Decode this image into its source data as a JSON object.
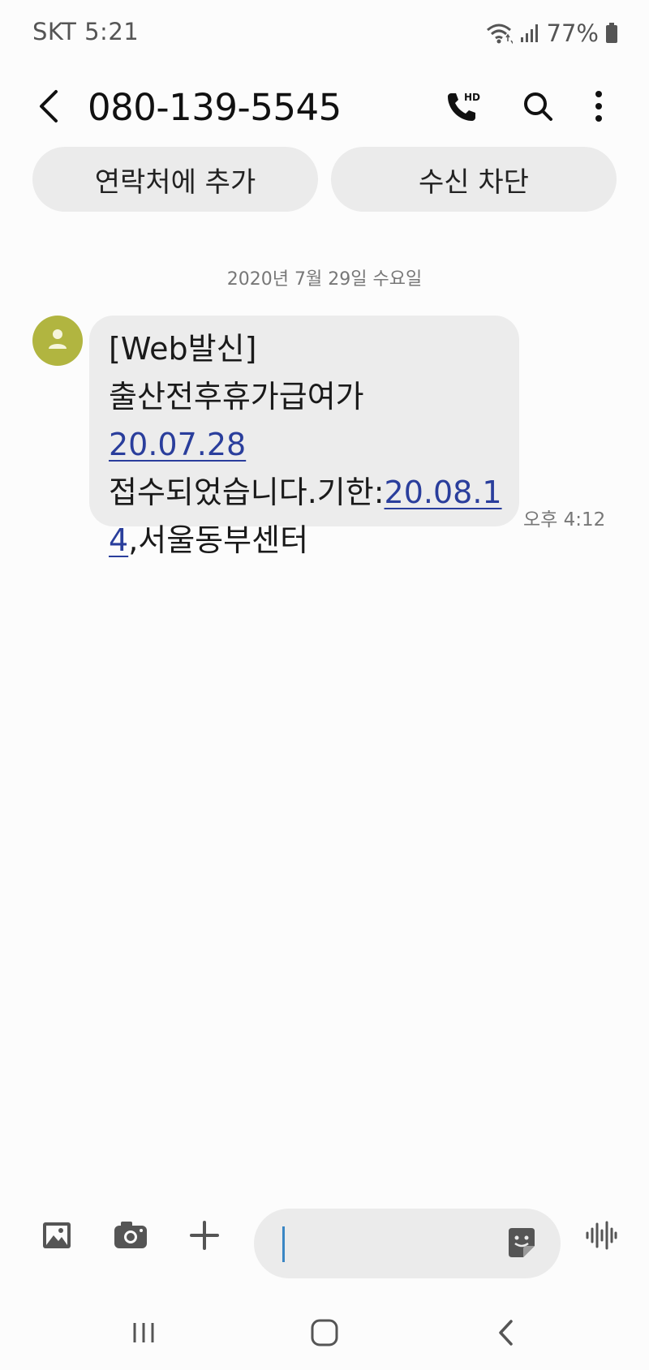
{
  "status_bar": {
    "carrier_time": "SKT 5:21",
    "battery": "77%"
  },
  "header": {
    "title": "080-139-5545"
  },
  "actions": {
    "add_contact": "연락처에 추가",
    "block": "수신 차단"
  },
  "conversation": {
    "date": "2020년 7월 29일 수요일",
    "message": {
      "line1": "[Web발신]",
      "line2": "출산전후휴가급여가",
      "link1": "20.07.28",
      "line4_text": "접수되었습니다.기한:",
      "link2_part1": "20.08.1",
      "link2_part2": "4",
      "line5_text": ",서울동부센터",
      "time": "오후 4:12"
    }
  },
  "composer": {
    "text": ""
  },
  "colors": {
    "avatar": "#b1b540",
    "link": "#2a3e9c",
    "cursor": "#3a86c4"
  }
}
